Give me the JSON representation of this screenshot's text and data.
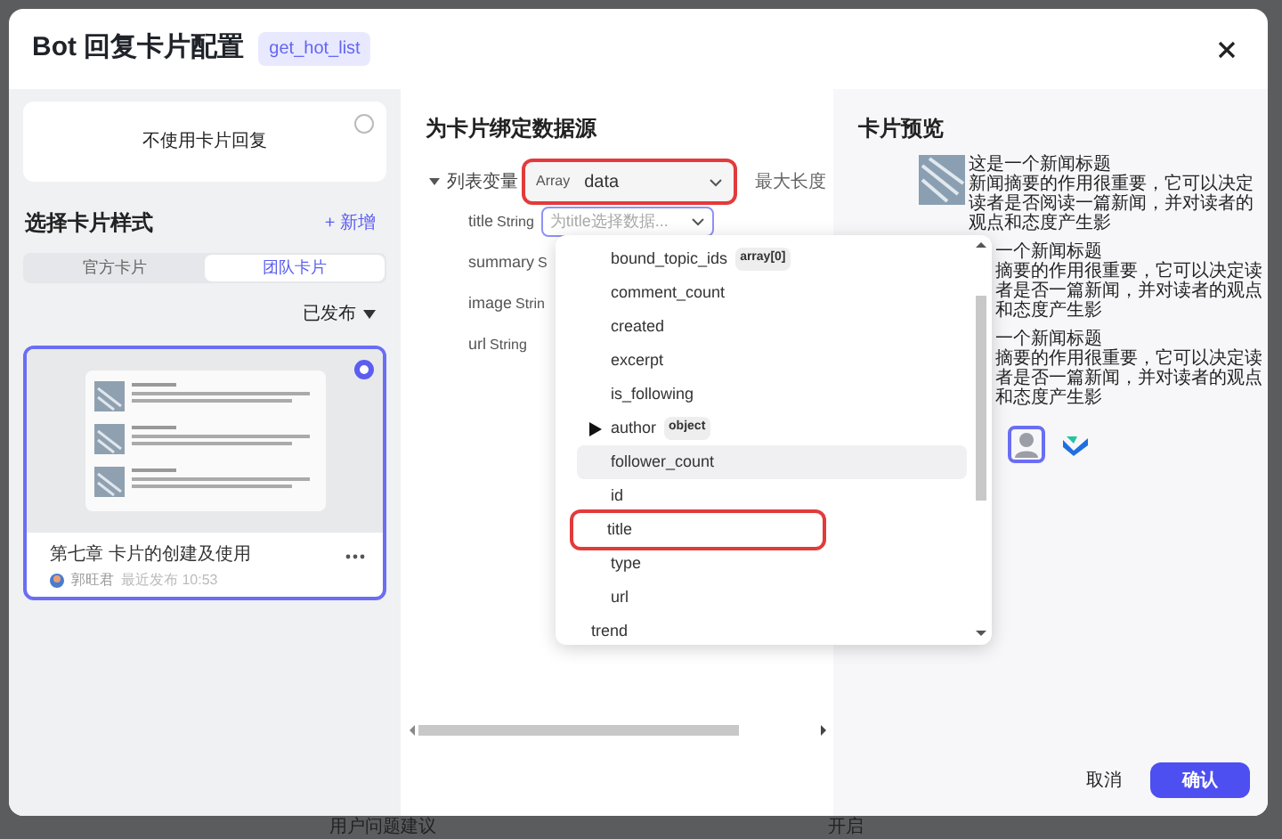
{
  "background": {
    "texts": [
      "用户问题建议",
      "开启"
    ]
  },
  "window": {
    "title": "Bot 回复卡片配置",
    "tag": "get_hot_list"
  },
  "left": {
    "no_card": {
      "label": "不使用卡片回复",
      "selected": false
    },
    "heading": "选择卡片样式",
    "add": "+ 新增",
    "tabs": [
      {
        "label": "官方卡片",
        "selected": false
      },
      {
        "label": "团队卡片",
        "selected": true
      }
    ],
    "filter": "已发布",
    "cards": [
      {
        "title": "第七章 卡片的创建及使用",
        "author": "郭旺君",
        "meta": "最近发布 10:53",
        "selected": true
      }
    ]
  },
  "middle": {
    "heading": "为卡片绑定数据源",
    "list_var": {
      "label": "列表变量",
      "type": "Array",
      "value": "data",
      "annotated": true,
      "max_label": "最大长度"
    },
    "fields": [
      {
        "name": "title",
        "type": "String",
        "placeholder": "为title选择数据...",
        "focused": true
      },
      {
        "name": "summary",
        "type": "S"
      },
      {
        "name": "image",
        "type": "Strin"
      },
      {
        "name": "url",
        "type": "String"
      }
    ],
    "dropdown": [
      {
        "children": [
          {
            "label": "bound_topic_ids",
            "tag": "array[0]",
            "highlighted": false,
            "annotated": false
          },
          {
            "label": "comment_count",
            "highlighted": false,
            "annotated": false
          },
          {
            "label": "created",
            "highlighted": false,
            "annotated": false
          },
          {
            "label": "excerpt",
            "highlighted": false,
            "annotated": false
          },
          {
            "label": "is_following",
            "highlighted": false,
            "annotated": false
          },
          {
            "label": "author",
            "tag": "object",
            "expanded": false,
            "highlighted": false,
            "annotated": false
          },
          {
            "label": "follower_count",
            "highlighted": true,
            "annotated": false
          },
          {
            "label": "id",
            "highlighted": false,
            "annotated": false
          },
          {
            "label": "title",
            "highlighted": false,
            "annotated": true
          },
          {
            "label": "type",
            "highlighted": false,
            "annotated": false
          },
          {
            "label": "url",
            "highlighted": false,
            "annotated": false
          }
        ]
      },
      {
        "label": "trend",
        "highlighted": false,
        "annotated": false
      }
    ]
  },
  "right": {
    "heading": "卡片预览",
    "preview": [
      {
        "kind": "full",
        "title": "这是一个新闻标题",
        "summary": "新闻摘要的作用很重要，它可以决定读者是否阅读一篇新闻，并对读者的观点和态度产生影"
      },
      {
        "kind": "partial",
        "title": "一个新闻标题",
        "summary": "摘要的作用很重要，它可以决定读者是否一篇新闻，并对读者的观点和态度产生影"
      },
      {
        "kind": "partial",
        "title": "一个新闻标题",
        "summary": "摘要的作用很重要，它可以决定读者是否一篇新闻，并对读者的观点和态度产生影"
      }
    ],
    "avatars": [
      {
        "kind": "person",
        "selected": true
      },
      {
        "kind": "logo",
        "selected": false
      }
    ],
    "buttons": [
      {
        "label": "取消",
        "kind": "secondary"
      },
      {
        "label": "确认",
        "kind": "primary"
      }
    ]
  }
}
